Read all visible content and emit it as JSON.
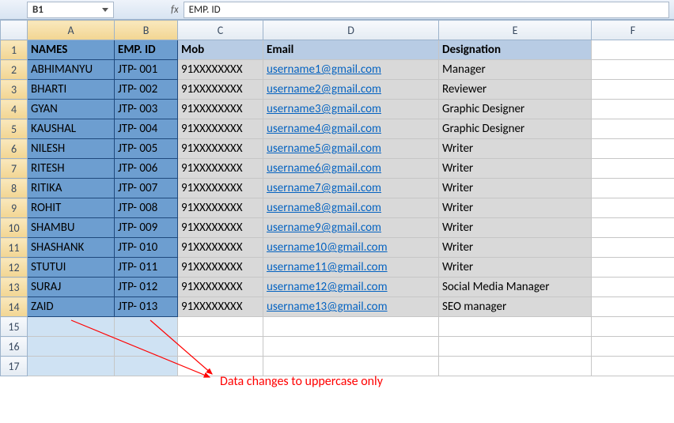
{
  "formula_bar": {
    "name_box": "B1",
    "fx_label": "fx",
    "formula": "EMP. ID"
  },
  "col_headers": [
    "A",
    "B",
    "C",
    "D",
    "E",
    "F"
  ],
  "row_headers": [
    "1",
    "2",
    "3",
    "4",
    "5",
    "6",
    "7",
    "8",
    "9",
    "10",
    "11",
    "12",
    "13",
    "14",
    "15",
    "16",
    "17"
  ],
  "headers": {
    "A": "NAMES",
    "B": "EMP. ID",
    "C": "Mob",
    "D": "Email",
    "E": "Designation"
  },
  "rows": [
    {
      "A": "ABHIMANYU",
      "B": "JTP- 001",
      "C": "91XXXXXXXX",
      "D": "username1@gmail.com",
      "E": "Manager"
    },
    {
      "A": "BHARTI",
      "B": "JTP- 002",
      "C": "91XXXXXXXX",
      "D": "username2@gmail.com",
      "E": "Reviewer"
    },
    {
      "A": "GYAN",
      "B": "JTP- 003",
      "C": "91XXXXXXXX",
      "D": "username3@gmail.com",
      "E": "Graphic Designer"
    },
    {
      "A": "KAUSHAL",
      "B": "JTP- 004",
      "C": "91XXXXXXXX",
      "D": "username4@gmail.com",
      "E": "Graphic Designer"
    },
    {
      "A": "NILESH",
      "B": "JTP- 005",
      "C": "91XXXXXXXX",
      "D": "username5@gmail.com",
      "E": "Writer"
    },
    {
      "A": "RITESH",
      "B": "JTP- 006",
      "C": "91XXXXXXXX",
      "D": "username6@gmail.com",
      "E": "Writer"
    },
    {
      "A": "RITIKA",
      "B": "JTP- 007",
      "C": "91XXXXXXXX",
      "D": "username7@gmail.com",
      "E": "Writer"
    },
    {
      "A": "ROHIT",
      "B": "JTP- 008",
      "C": "91XXXXXXXX",
      "D": "username8@gmail.com",
      "E": "Writer"
    },
    {
      "A": "SHAMBU",
      "B": "JTP- 009",
      "C": "91XXXXXXXX",
      "D": "username9@gmail.com",
      "E": "Writer"
    },
    {
      "A": "SHASHANK",
      "B": "JTP- 010",
      "C": "91XXXXXXXX",
      "D": "username10@gmail.com",
      "E": "Writer"
    },
    {
      "A": "STUTUI",
      "B": "JTP- 011",
      "C": "91XXXXXXXX",
      "D": "username11@gmail.com",
      "E": "Writer"
    },
    {
      "A": "SURAJ",
      "B": "JTP- 012",
      "C": "91XXXXXXXX",
      "D": "username12@gmail.com",
      "E": "Social Media Manager"
    },
    {
      "A": "ZAID",
      "B": "JTP- 013",
      "C": "91XXXXXXXX",
      "D": "username13@gmail.com",
      "E": "SEO manager"
    }
  ],
  "annotation": {
    "text": "Data changes to uppercase only"
  }
}
